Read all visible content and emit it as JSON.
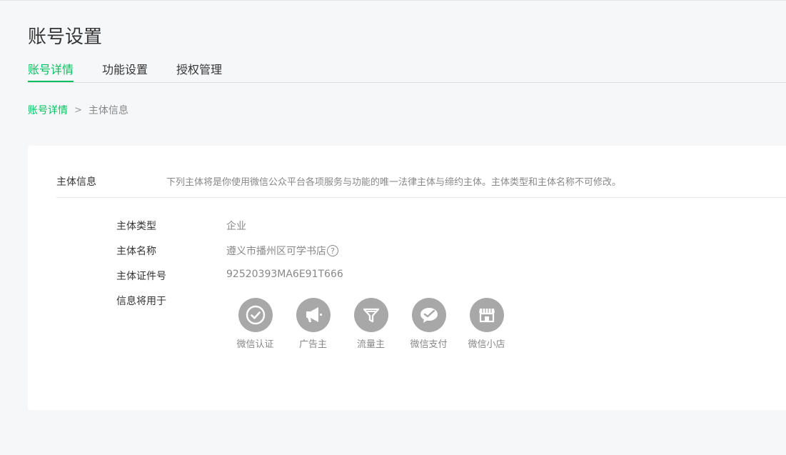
{
  "page": {
    "title": "账号设置"
  },
  "tabs": [
    {
      "label": "账号详情",
      "active": true
    },
    {
      "label": "功能设置",
      "active": false
    },
    {
      "label": "授权管理",
      "active": false
    }
  ],
  "breadcrumb": {
    "parent": "账号详情",
    "separator": ">",
    "current": "主体信息"
  },
  "section": {
    "title": "主体信息",
    "description": "下列主体将是你使用微信公众平台各项服务与功能的唯一法律主体与缔约主体。主体类型和主体名称不可修改。"
  },
  "fields": {
    "type": {
      "label": "主体类型",
      "value": "企业"
    },
    "name": {
      "label": "主体名称",
      "value": "遵义市播州区可学书店",
      "help": "?"
    },
    "cert": {
      "label": "主体证件号",
      "value": "92520393MA6E91T666"
    },
    "usage": {
      "label": "信息将用于"
    }
  },
  "uses": [
    {
      "label": "微信认证",
      "icon": "check-circle-icon"
    },
    {
      "label": "广告主",
      "icon": "megaphone-icon"
    },
    {
      "label": "流量主",
      "icon": "funnel-icon"
    },
    {
      "label": "微信支付",
      "icon": "wechat-pay-icon"
    },
    {
      "label": "微信小店",
      "icon": "shop-icon"
    }
  ],
  "colors": {
    "accent": "#07c160",
    "icon_bg": "#a8a8a8",
    "page_bg": "#f6f7f9",
    "card_bg": "#ffffff"
  }
}
